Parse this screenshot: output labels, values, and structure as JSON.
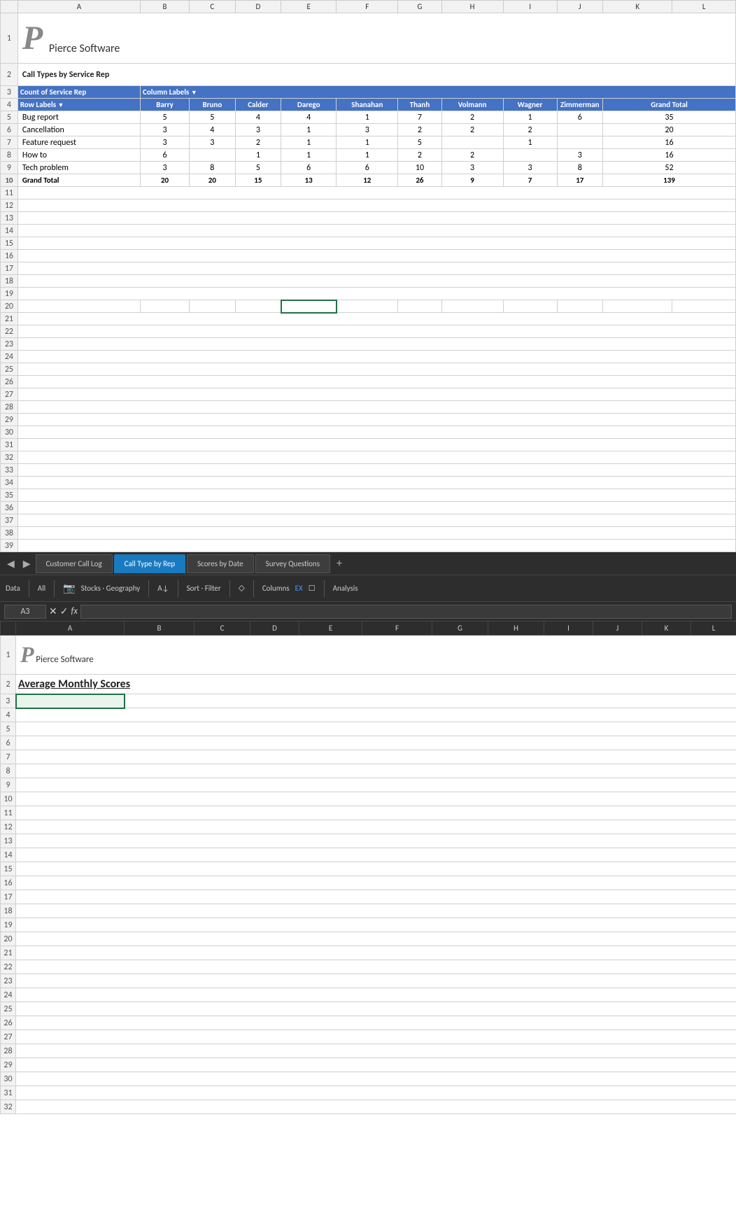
{
  "topSheet": {
    "title": "Call Types by Service Rep",
    "company": "Pierce Software",
    "pivotHeader": {
      "countLabel": "Count of Service Rep",
      "columnLabels": "Column Labels",
      "rowLabels": "Row Labels",
      "columns": [
        "Barry",
        "Bruno",
        "Calder",
        "Darego",
        "Shanahan",
        "Thanh",
        "Volmann",
        "Wagner",
        "Zimmerman",
        "Grand Total"
      ]
    },
    "rows": [
      {
        "label": "Bug report",
        "values": [
          5,
          5,
          4,
          4,
          1,
          7,
          2,
          1,
          6,
          35
        ]
      },
      {
        "label": "Cancellation",
        "values": [
          3,
          4,
          3,
          1,
          3,
          2,
          2,
          2,
          "",
          20
        ]
      },
      {
        "label": "Feature request",
        "values": [
          3,
          3,
          2,
          1,
          1,
          5,
          "",
          1,
          "",
          16
        ]
      },
      {
        "label": "How to",
        "values": [
          6,
          "",
          1,
          1,
          1,
          2,
          2,
          "",
          3,
          16
        ]
      },
      {
        "label": "Tech problem",
        "values": [
          3,
          8,
          5,
          6,
          6,
          10,
          3,
          3,
          8,
          52
        ]
      }
    ],
    "grandTotal": {
      "label": "Grand Total",
      "values": [
        20,
        20,
        15,
        13,
        12,
        26,
        9,
        7,
        17,
        139
      ]
    },
    "selectedCell": "F20"
  },
  "tabs": [
    {
      "label": "Customer Call Log",
      "active": false
    },
    {
      "label": "Call Type by Rep",
      "active": true
    },
    {
      "label": "Scores by Date",
      "active": false
    },
    {
      "label": "Survey Questions",
      "active": false
    }
  ],
  "ribbon": {
    "items": [
      "Data",
      "All",
      "Stocks · Geography",
      "A↓",
      "Sort · Filter",
      "Columns",
      "EX",
      "Analysis"
    ]
  },
  "formulaBar": {
    "cellRef": "A3",
    "formula": "fx"
  },
  "bottomSheet": {
    "title": "Average Monthly Scores",
    "company": "Pierce Software",
    "selectedCell": "A3"
  },
  "columnHeaders": [
    "A",
    "B",
    "C",
    "D",
    "E",
    "F",
    "G",
    "H",
    "I",
    "J",
    "K",
    "L"
  ],
  "rowNumbers": [
    1,
    2,
    3,
    4,
    5,
    6,
    7,
    8,
    9,
    10,
    11,
    12,
    13,
    14,
    15,
    16,
    17,
    18,
    19,
    20,
    21,
    22,
    23,
    24,
    25,
    26,
    27,
    28,
    29,
    30,
    31,
    32,
    33,
    34,
    35,
    36,
    37,
    38,
    39
  ]
}
